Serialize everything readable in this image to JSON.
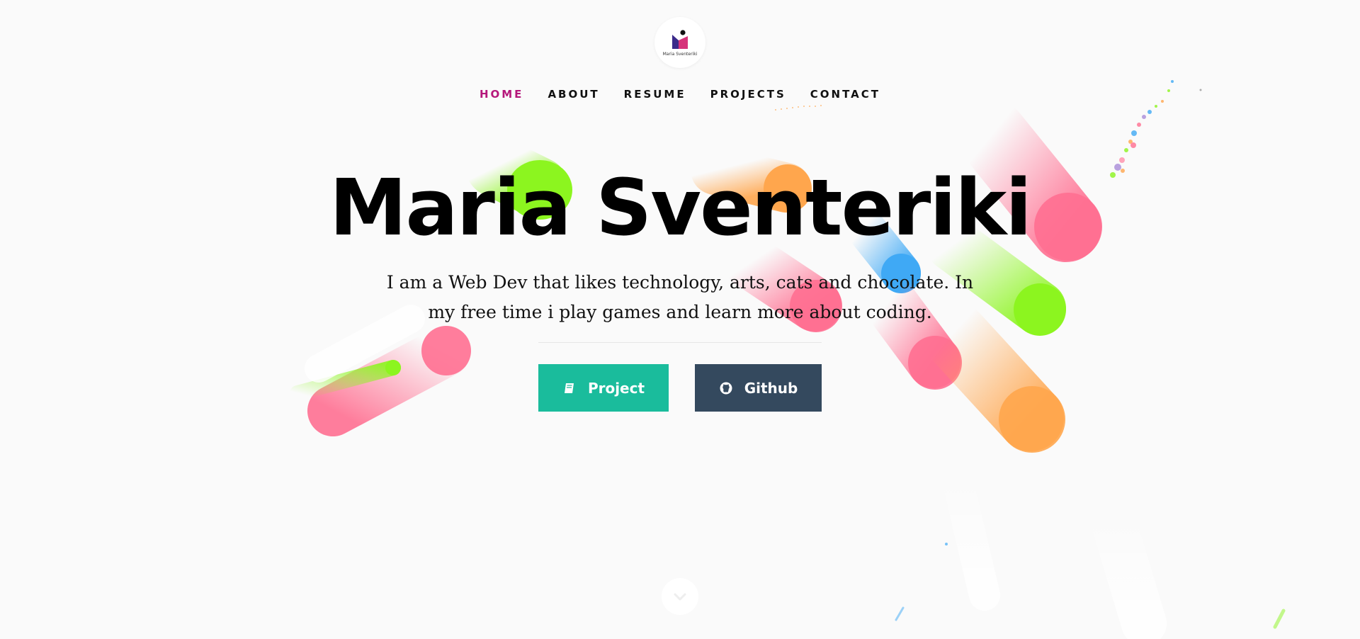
{
  "logo": {
    "text": "Maria Sventeriki",
    "brand_colors": [
      "#3b2a8a",
      "#d6337a",
      "#111111"
    ]
  },
  "nav": {
    "items": [
      {
        "label": "HOME",
        "active": true
      },
      {
        "label": "ABOUT",
        "active": false
      },
      {
        "label": "RESUME",
        "active": false
      },
      {
        "label": "PROJECTS",
        "active": false
      },
      {
        "label": "CONTACT",
        "active": false
      }
    ],
    "active_color": "#b5177b"
  },
  "hero": {
    "title": "Maria Sventeriki",
    "subtitle": "I am a Web Dev that likes technology, arts, cats and chocolate. In my free time i play games and learn more about coding."
  },
  "buttons": {
    "project_label": "Project",
    "project_icon": "book-icon",
    "project_color": "#1abc9c",
    "github_label": "Github",
    "github_icon": "github-icon",
    "github_color": "#34495e"
  },
  "scroll": {
    "icon": "chevron-down-icon"
  },
  "decor_colors": [
    "#ff6f91",
    "#8cf51f",
    "#ffa64d",
    "#3fa9f5"
  ]
}
